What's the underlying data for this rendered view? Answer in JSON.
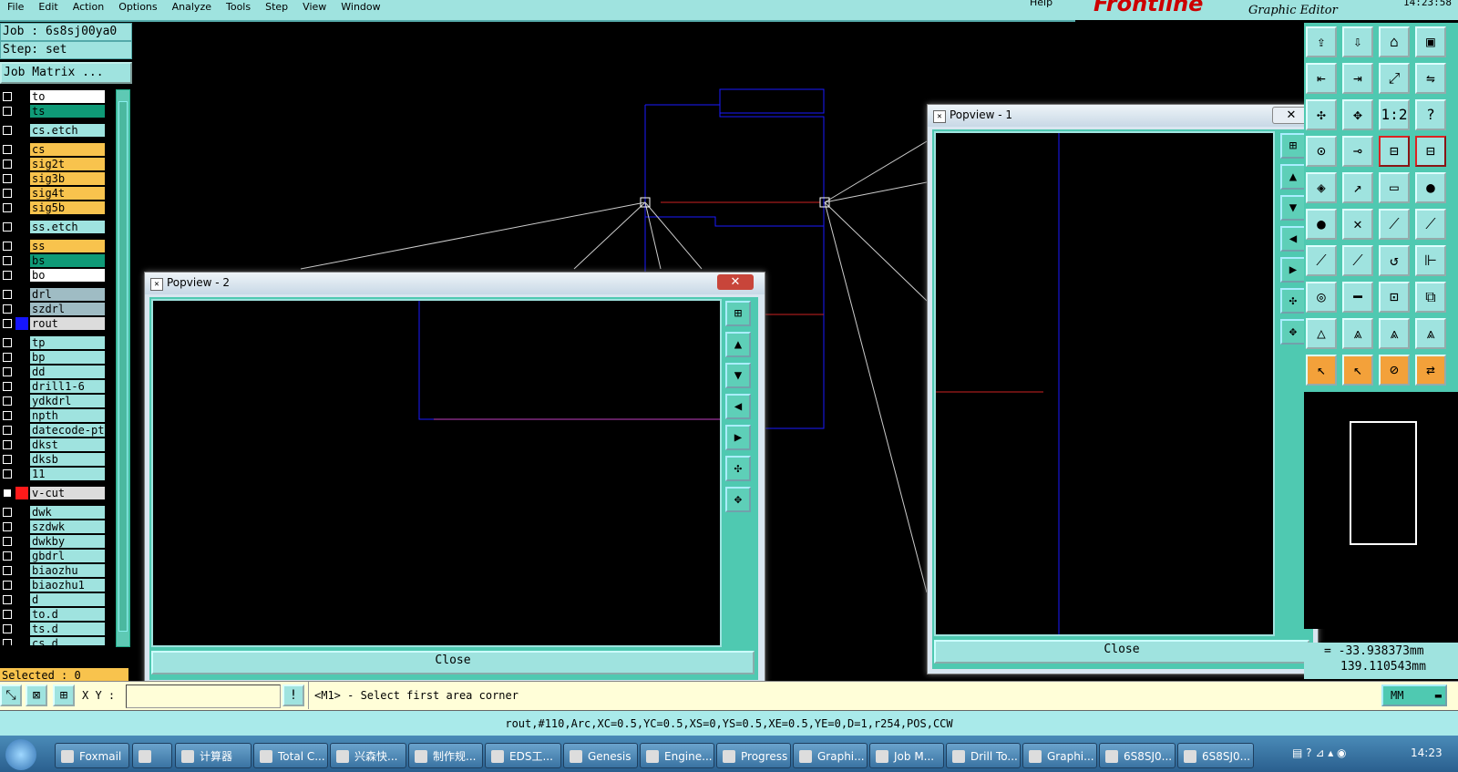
{
  "menubar": {
    "items": [
      "File",
      "Edit",
      "Action",
      "Options",
      "Analyze",
      "Tools",
      "Step",
      "View",
      "Window"
    ],
    "help": "Help"
  },
  "brand": {
    "logo": "Frontline",
    "subtitle": "Graphic Editor",
    "time": "14:23:58"
  },
  "job": {
    "job_label": "Job : 6s8sj00ya0",
    "step_label": "Step: set",
    "matrix_button": "Job Matrix ..."
  },
  "layers": [
    {
      "name": "to",
      "color": "#ffffff"
    },
    {
      "name": "ts",
      "color": "#0f9a77"
    },
    null,
    {
      "name": "cs.etch",
      "color": "#9fe3df"
    },
    null,
    {
      "name": "cs",
      "color": "#f8c34d"
    },
    {
      "name": "sig2t",
      "color": "#f8c34d"
    },
    {
      "name": "sig3b",
      "color": "#f8c34d"
    },
    {
      "name": "sig4t",
      "color": "#f8c34d"
    },
    {
      "name": "sig5b",
      "color": "#f8c34d"
    },
    null,
    {
      "name": "ss.etch",
      "color": "#9fe3df"
    },
    null,
    {
      "name": "ss",
      "color": "#f8c34d"
    },
    {
      "name": "bs",
      "color": "#0f9a77"
    },
    {
      "name": "bo",
      "color": "#ffffff"
    },
    null,
    {
      "name": "drl",
      "color": "#9fbcc4"
    },
    {
      "name": "szdrl",
      "color": "#9fbcc4"
    },
    {
      "name": "rout",
      "color": "#dcdcdc",
      "swatch": "#1515ff"
    },
    null,
    {
      "name": "tp",
      "color": "#9fe3df"
    },
    {
      "name": "bp",
      "color": "#9fe3df"
    },
    {
      "name": "dd",
      "color": "#9fe3df"
    },
    {
      "name": "drill1-6",
      "color": "#9fe3df"
    },
    {
      "name": "ydkdrl",
      "color": "#9fe3df"
    },
    {
      "name": "npth",
      "color": "#9fe3df"
    },
    {
      "name": "datecode-pte",
      "color": "#9fe3df"
    },
    {
      "name": "dkst",
      "color": "#9fe3df"
    },
    {
      "name": "dksb",
      "color": "#9fe3df"
    },
    {
      "name": "11",
      "color": "#9fe3df"
    },
    null,
    {
      "name": "v-cut",
      "color": "#dcdcdc",
      "swatch": "#ff1a1a",
      "checked": true
    },
    null,
    {
      "name": "dwk",
      "color": "#9fe3df"
    },
    {
      "name": "szdwk",
      "color": "#9fe3df"
    },
    {
      "name": "dwkby",
      "color": "#9fe3df"
    },
    {
      "name": "gbdrl",
      "color": "#9fe3df"
    },
    {
      "name": "biaozhu",
      "color": "#9fe3df"
    },
    {
      "name": "biaozhu1",
      "color": "#9fe3df"
    },
    {
      "name": "d",
      "color": "#9fe3df"
    },
    {
      "name": "to.d",
      "color": "#9fe3df"
    },
    {
      "name": "ts.d",
      "color": "#9fe3df"
    },
    {
      "name": "cs.d",
      "color": "#9fe3df"
    }
  ],
  "selected_label": "Selected : 0",
  "popview2": {
    "title": "Popview - 2",
    "close": "Close"
  },
  "popview1": {
    "title": "Popview - 1",
    "close": "Close"
  },
  "coords": {
    "x": "= -33.938373mm",
    "y": "139.110543mm"
  },
  "cmd": {
    "xy_label": "X Y :",
    "prompt": "<M1> - Select first area corner",
    "units": "MM"
  },
  "status_line": "rout,#110,Arc,XC=0.5,YC=0.5,XS=0,YS=0.5,XE=0.5,YE=0,D=1,r254,POS,CCW",
  "taskbar": {
    "items": [
      "Foxmail",
      "",
      "计算器",
      "Total C...",
      "兴森快...",
      "制作规...",
      "EDS工...",
      "Genesis",
      "Engine...",
      "Progress",
      "Graphi...",
      "Job M...",
      "Drill To...",
      "Graphi...",
      "6S8SJ0...",
      "6S8SJ0..."
    ],
    "clock": "14:23"
  },
  "colors": {
    "accent": "#9fe3df",
    "panel": "#4fc9b1",
    "layer_signal": "#f8c34d",
    "selection": "#f3a13a"
  }
}
